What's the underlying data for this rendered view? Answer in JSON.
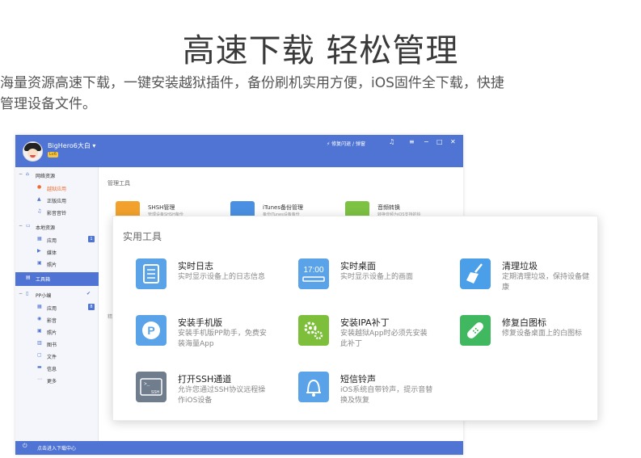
{
  "headline": "高速下载 轻松管理",
  "subline": [
    "海量资源高速下载，一键安装越狱插件，备份刷机实用方便，iOS固件全下载，快捷",
    "管理设备文件。"
  ],
  "window": {
    "user": {
      "name": "BigHero6大白 ▾",
      "badge": "Lv6"
    },
    "top_action": "⚡ 修复闪退 / 弹窗",
    "sidebar": {
      "groups": [
        {
          "label": "网络资源",
          "items": [
            {
              "label": "越狱应用",
              "icon": "jailbreak-icon"
            },
            {
              "label": "正版应用",
              "icon": "app-store-icon"
            },
            {
              "label": "影音音铃",
              "icon": "music-icon"
            }
          ]
        },
        {
          "label": "本地资源",
          "items": [
            {
              "label": "应用",
              "icon": "apps-icon",
              "count": "1"
            },
            {
              "label": "媒体",
              "icon": "media-icon"
            },
            {
              "label": "照片",
              "icon": "photo-icon"
            }
          ]
        },
        {
          "label": "工具箱",
          "active": true
        },
        {
          "label": "PP小编",
          "items": [
            {
              "label": "应用",
              "icon": "apps-icon",
              "count": "8"
            },
            {
              "label": "影音",
              "icon": "video-icon"
            },
            {
              "label": "照片",
              "icon": "photo-icon"
            },
            {
              "label": "图书",
              "icon": "book-icon"
            },
            {
              "label": "文件",
              "icon": "file-icon"
            },
            {
              "label": "信息",
              "icon": "message-icon"
            },
            {
              "label": "更多",
              "icon": "more-icon"
            }
          ]
        }
      ],
      "footer": "点击进入下载中心"
    },
    "main": {
      "section": "管理工具",
      "manage_tools": [
        {
          "name": "SHSH管理",
          "desc": "管理设备SHSH备份",
          "color": "#f2a22c"
        },
        {
          "name": "iTunes备份管理",
          "desc": "备份iTunes设备备份",
          "color": "#4a90e2"
        },
        {
          "name": "音频转换",
          "desc": "转换音频为iOS支持的铃",
          "color": "#7dc243"
        }
      ],
      "stub": "精"
    }
  },
  "panel": {
    "title": "实用工具",
    "tools": [
      {
        "name": "实时日志",
        "desc": "实时显示设备上的日志信息",
        "color": "#5aa3e8",
        "icon": "log-icon"
      },
      {
        "name": "实时桌面",
        "desc": "实时显示设备上的画面",
        "color": "#5aa3e8",
        "icon": "desktop-icon",
        "glyph": "17:00"
      },
      {
        "name": "清理垃圾",
        "desc": "定期清理垃圾，保持设备健康",
        "color": "#4a9fe8",
        "icon": "broom-icon"
      },
      {
        "name": "安装手机版",
        "desc": "安装手机版PP助手，免费安装海量App",
        "color": "#5aa3e8",
        "icon": "pp-icon",
        "glyph": "P"
      },
      {
        "name": "安装IPA补丁",
        "desc": "安装越狱App时必须先安装此补丁",
        "color": "#7dbf3a",
        "icon": "gear-icon"
      },
      {
        "name": "修复白图标",
        "desc": "修复设备桌面上的白图标",
        "color": "#3fb85f",
        "icon": "bandage-icon"
      },
      {
        "name": "打开SSH通道",
        "desc": "允许您通过SSH协议远程操作iOS设备",
        "color": "#6f7d8c",
        "icon": "ssh-icon",
        "glyph": "SSH"
      },
      {
        "name": "短信铃声",
        "desc": "iOS系统自带铃声，提示音替换及恢复",
        "color": "#5aa3e8",
        "icon": "bell-icon"
      }
    ]
  }
}
